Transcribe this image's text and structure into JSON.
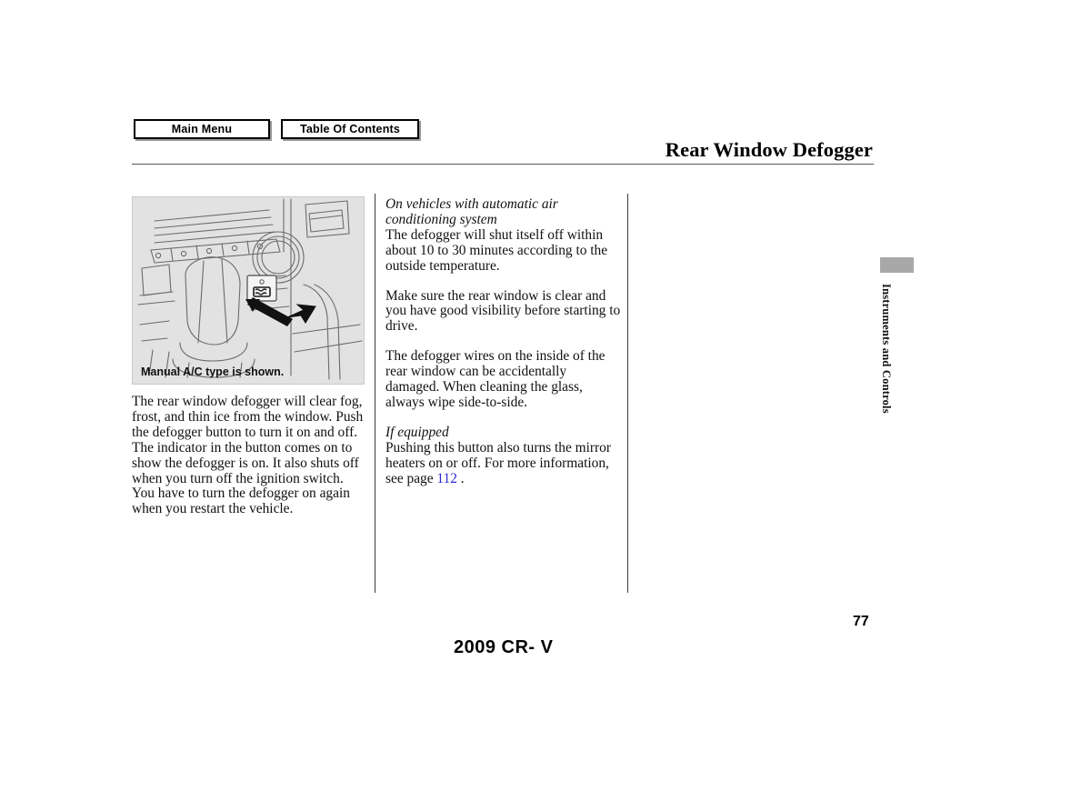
{
  "toolbar": {
    "main_menu_label": "Main Menu",
    "table_of_contents_label": "Table Of Contents"
  },
  "header": {
    "title": "Rear Window Defogger"
  },
  "figure": {
    "caption": "Manual A/C type is shown.",
    "alt_name": "center-console-defogger-button-illustration"
  },
  "left_column": {
    "paragraph_1": "The rear window defogger will clear fog, frost, and thin ice from the window. Push the defogger button to turn it on and off. The indicator in the button comes on to show the defogger is on. It also shuts off when you turn off the ignition switch. You have to turn the defogger on again when you restart the vehicle."
  },
  "right_column": {
    "subhead_1": "On vehicles with automatic air conditioning system",
    "paragraph_1": "The defogger will shut itself off within about 10 to 30 minutes according to the outside temperature.",
    "paragraph_2": "Make sure the rear window is clear and you have good visibility before starting to drive.",
    "paragraph_3": "The defogger wires on the inside of the rear window can be accidentally damaged. When cleaning the glass, always wipe side-to-side.",
    "subhead_2": "If equipped",
    "paragraph_4_before_link": "Pushing this button also turns the mirror heaters on or off. For more information, see page ",
    "paragraph_4_link": "112",
    "paragraph_4_after_link": " ."
  },
  "sidebar": {
    "section_label": "Instruments and Controls"
  },
  "footer": {
    "page_number": "77",
    "model": "2009  CR- V"
  },
  "colors": {
    "link": "#2a2ad0",
    "figure_background": "#e2e2e2",
    "thumb_tab": "#a8a8a8",
    "rule": "#555555"
  }
}
